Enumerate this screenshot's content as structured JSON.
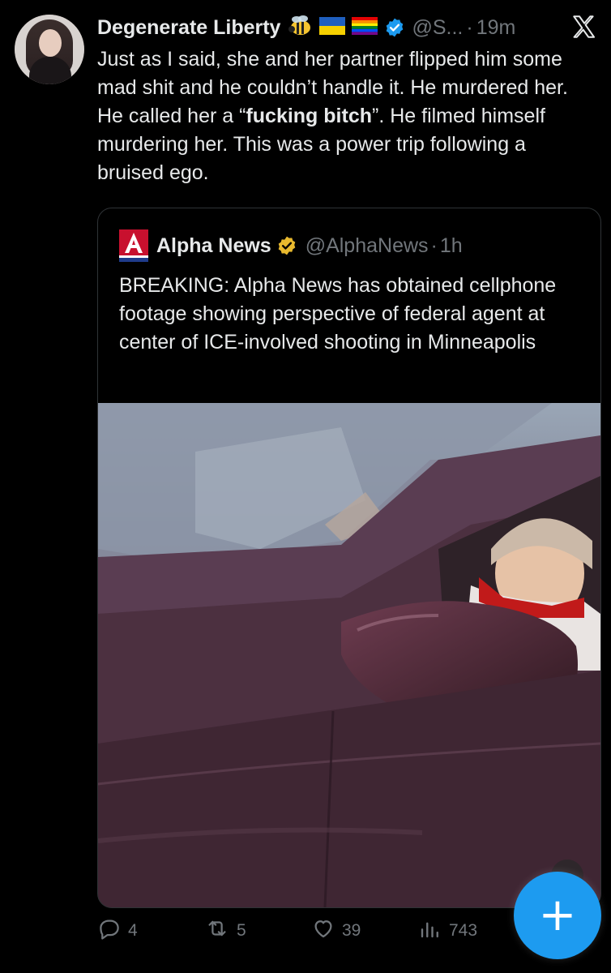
{
  "post": {
    "author_name": "Degenerate Liberty",
    "emojis": [
      "bee",
      "ukraine-flag",
      "rainbow-flag"
    ],
    "handle": "@S...",
    "dot": "·",
    "time": "19m",
    "text_before": "Just as I said, she and her partner flipped him some mad shit and he couldn’t handle it. He murdered her. He called her a “",
    "text_bold": "fucking bitch",
    "text_after": "”. He filmed himself murdering her. This was a power trip following a bruised ego."
  },
  "quote": {
    "author_name": "Alpha News",
    "handle": "@AlphaNews",
    "dot": "·",
    "time": "1h",
    "text": "BREAKING: Alpha News has obtained cellphone footage showing perspective of federal agent at center of ICE-involved shooting in Minneapolis"
  },
  "actions": {
    "replies": "4",
    "reposts": "5",
    "likes": "39",
    "views": "743"
  },
  "fab_label": "+",
  "colors": {
    "background": "#000000",
    "text": "#e7e9ea",
    "muted": "#71767b",
    "accent": "#1d9bf0",
    "verified_quote": "#e8b92e"
  }
}
